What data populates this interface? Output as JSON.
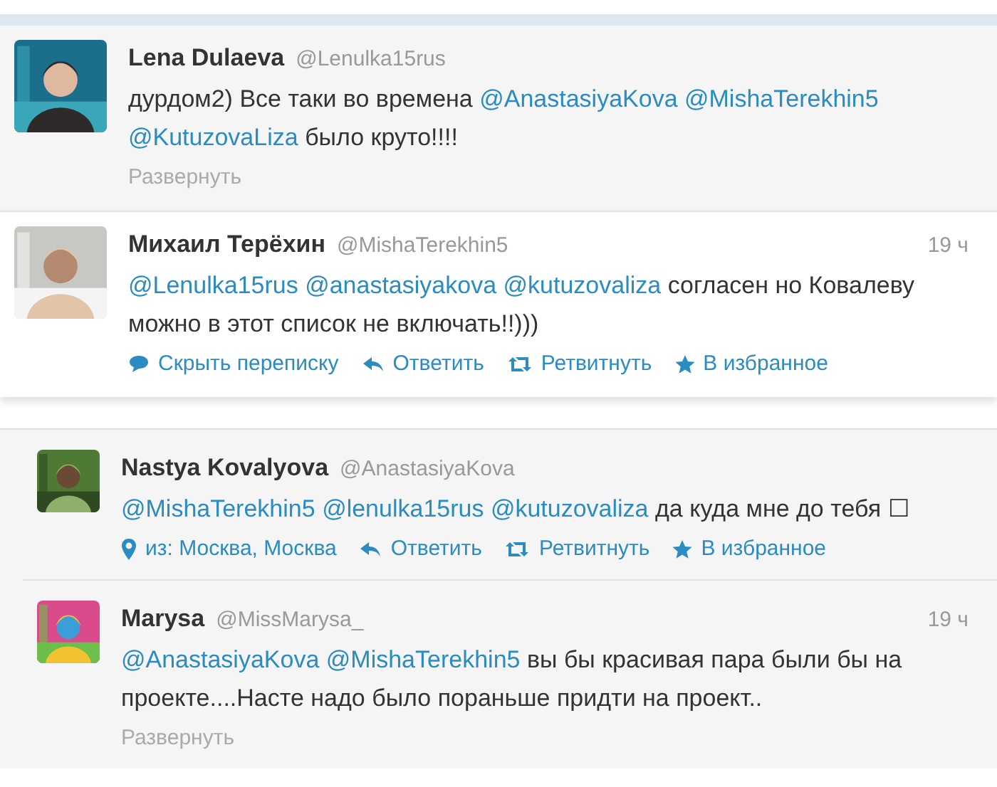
{
  "threads": [
    {
      "tweets": [
        {
          "name": "Lena Dulaeva",
          "handle": "@Lenulka15rus",
          "expanded": false,
          "avatar": {
            "kind": "picture"
          },
          "text": [
            {
              "kind": "plain",
              "text": "дурдом2) Все таки во времена"
            },
            {
              "kind": "mention",
              "text": "@AnastasiyaKova"
            },
            {
              "kind": "mention",
              "text": "@MishaTerekhin5"
            },
            {
              "kind": "mention",
              "text": "@KutuzovaLiza"
            },
            {
              "kind": "plain",
              "text": "было круто!!!!"
            }
          ],
          "actions": [
            {
              "kind": "expand",
              "label": "Развернуть"
            }
          ]
        },
        {
          "name": "Михаил Терёхин",
          "handle": "@MishaTerekhin5",
          "time": "19 ч",
          "expanded": true,
          "avatar": {
            "kind": "picture"
          },
          "text": [
            {
              "kind": "mention",
              "text": "@Lenulka15rus"
            },
            {
              "kind": "mention",
              "text": "@anastasiyakova"
            },
            {
              "kind": "mention",
              "text": "@kutuzovaliza"
            },
            {
              "kind": "plain",
              "text": "согласен но Ковалеву можно в этот список не включать!!)))"
            }
          ],
          "actions": [
            {
              "kind": "hide",
              "label": "Скрыть переписку"
            },
            {
              "kind": "reply",
              "label": "Ответить"
            },
            {
              "kind": "retweet",
              "label": "Ретвитнуть"
            },
            {
              "kind": "favorite",
              "label": "В избранное"
            }
          ]
        }
      ]
    },
    {
      "tweets": [
        {
          "name": "Nastya Kovalyova",
          "handle": "@AnastasiyaKova",
          "expanded": false,
          "avatar": {
            "kind": "picture"
          },
          "text": [
            {
              "kind": "mention",
              "text": "@MishaTerekhin5"
            },
            {
              "kind": "mention",
              "text": "@lenulka15rus"
            },
            {
              "kind": "mention",
              "text": "@kutuzovaliza"
            },
            {
              "kind": "plain",
              "text": "да куда мне до тебя ☐"
            }
          ],
          "actions": [
            {
              "kind": "location",
              "label": "из: Москва, Москва"
            },
            {
              "kind": "reply",
              "label": "Ответить"
            },
            {
              "kind": "retweet",
              "label": "Ретвитнуть"
            },
            {
              "kind": "favorite",
              "label": "В избранное"
            }
          ]
        },
        {
          "name": "Marysa",
          "handle": "@MissMarysa_",
          "time": "19 ч",
          "expanded": false,
          "avatar": {
            "kind": "picture"
          },
          "text": [
            {
              "kind": "mention",
              "text": "@AnastasiyaKova"
            },
            {
              "kind": "mention",
              "text": "@MishaTerekhin5"
            },
            {
              "kind": "plain",
              "text": "вы бы красивая пара были бы на проекте....Насте надо было пораньше придти на проект.."
            }
          ],
          "actions": [
            {
              "kind": "expand",
              "label": "Развернуть"
            }
          ]
        }
      ]
    }
  ]
}
